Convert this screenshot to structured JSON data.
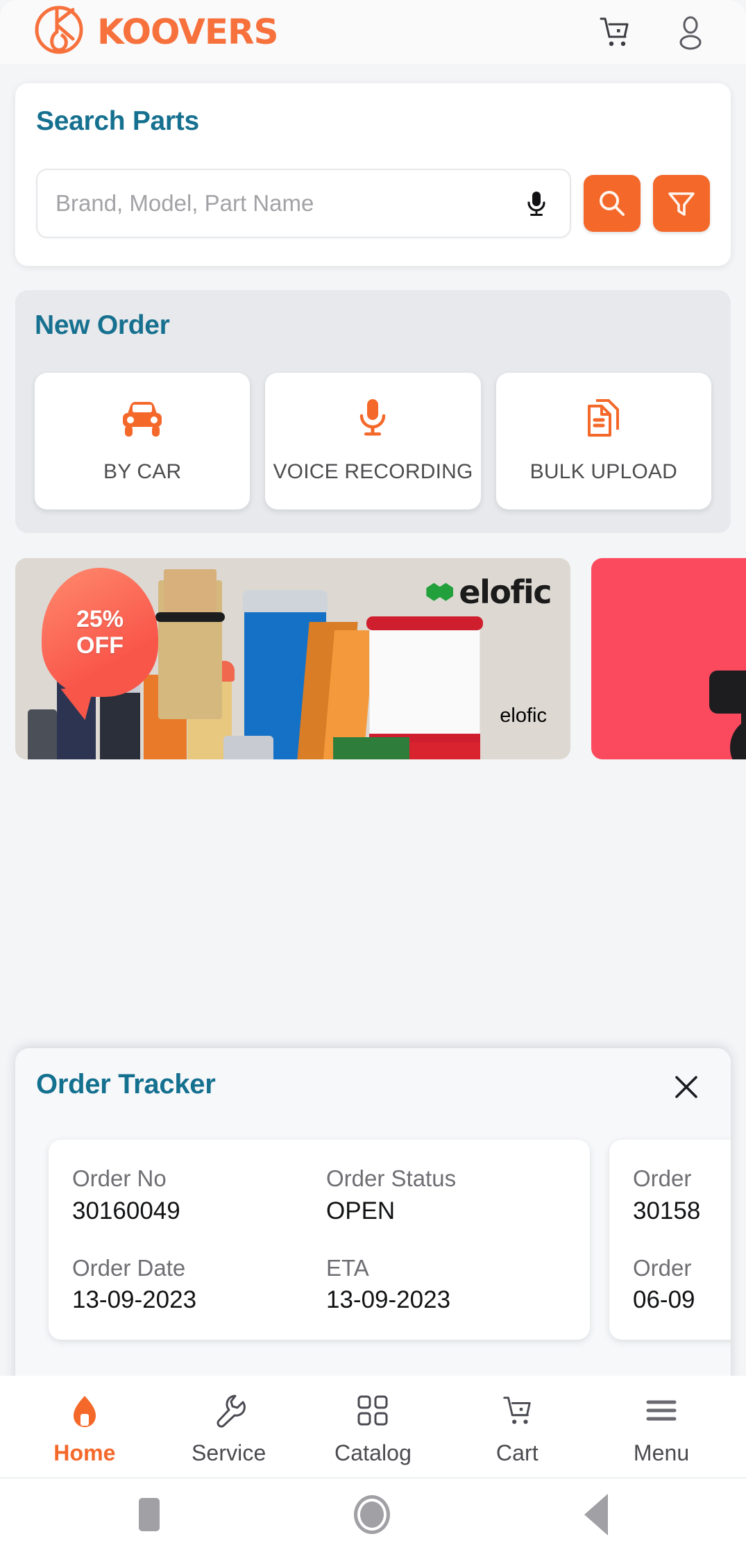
{
  "header": {
    "brand_name": "KOOVERS",
    "logo_icon": "koovers-circle-k-logo",
    "cart_icon": "shopping-cart-icon",
    "profile_icon": "user-profile-icon",
    "brand_color": "#f7713c"
  },
  "search_section": {
    "title": "Search Parts",
    "placeholder": "Brand, Model, Part Name",
    "value": "",
    "mic_icon": "microphone-icon",
    "search_icon": "magnifier-icon",
    "filter_icon": "funnel-filter-icon",
    "accent_color": "#f4682a",
    "title_color": "#16708f"
  },
  "new_order": {
    "title": "New Order",
    "tiles": [
      {
        "label": "BY CAR",
        "icon": "car-front-icon"
      },
      {
        "label": "VOICE RECORDING",
        "icon": "microphone-icon"
      },
      {
        "label": "BULK UPLOAD",
        "icon": "document-upload-icon"
      }
    ]
  },
  "banners": [
    {
      "badge_line1": "25%",
      "badge_line2": "OFF",
      "brand": "elofic",
      "brand_small": "elofic",
      "background": "#ddd8d2"
    },
    {
      "background": "#fb4a5d"
    }
  ],
  "order_tracker": {
    "title": "Order Tracker",
    "close_icon": "close-x-icon",
    "orders": [
      {
        "order_no_label": "Order No",
        "order_no": "30160049",
        "status_label": "Order Status",
        "status": "OPEN",
        "date_label": "Order Date",
        "date": "13-09-2023",
        "eta_label": "ETA",
        "eta": "13-09-2023"
      },
      {
        "order_no_label": "Order",
        "order_no": "30158",
        "date_label": "Order",
        "date": "06-09"
      }
    ]
  },
  "bottom_nav": {
    "items": [
      {
        "label": "Home",
        "icon": "home-icon",
        "active": true
      },
      {
        "label": "Service",
        "icon": "wrench-icon",
        "active": false
      },
      {
        "label": "Catalog",
        "icon": "grid-squares-icon",
        "active": false
      },
      {
        "label": "Cart",
        "icon": "shopping-cart-icon",
        "active": false
      },
      {
        "label": "Menu",
        "icon": "hamburger-menu-icon",
        "active": false
      }
    ],
    "active_color": "#f4682a"
  },
  "system_nav": {
    "recents_icon": "square-recents-icon",
    "home_icon": "circle-home-icon",
    "back_icon": "triangle-back-icon"
  }
}
